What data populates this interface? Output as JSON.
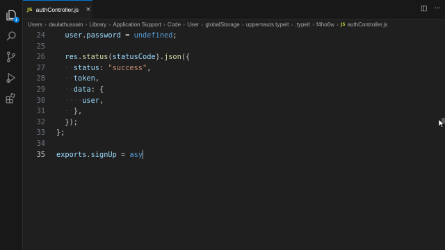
{
  "tab": {
    "label": "authController.js",
    "file_badge": "JS",
    "close": "×"
  },
  "tab_actions": {
    "split": "◫",
    "more": "···"
  },
  "breadcrumbs": [
    "Users",
    "daulathussain",
    "Library",
    "Application Support",
    "Code",
    "User",
    "globalStorage",
    "uppernauts.typeit",
    ".typeit",
    "f4ho6w",
    "authController.js"
  ],
  "breadcrumb_file_badge": "JS",
  "explorer_badge": "1",
  "lines": [
    {
      "n": "24",
      "indent": "",
      "code": [
        [
          "user",
          "#9cdcfe"
        ],
        [
          ".",
          "#cccccc"
        ],
        [
          "password",
          "#9cdcfe"
        ],
        [
          " = ",
          "#cccccc"
        ],
        [
          "undefined",
          "#569cd6"
        ],
        [
          ";",
          "#cccccc"
        ]
      ]
    },
    {
      "n": "25",
      "indent": "",
      "code": []
    },
    {
      "n": "26",
      "indent": "",
      "code": [
        [
          "res",
          "#9cdcfe"
        ],
        [
          ".",
          "#cccccc"
        ],
        [
          "status",
          "#dcdcaa"
        ],
        [
          "(",
          "#cccccc"
        ],
        [
          "statusCode",
          "#9cdcfe"
        ],
        [
          ").",
          "#cccccc"
        ],
        [
          "json",
          "#dcdcaa"
        ],
        [
          "({",
          "#cccccc"
        ]
      ]
    },
    {
      "n": "27",
      "indent": "··",
      "code": [
        [
          "status",
          "#9cdcfe"
        ],
        [
          ": ",
          "#cccccc"
        ],
        [
          "\"success\"",
          "#ce9178"
        ],
        [
          ",",
          "#cccccc"
        ]
      ]
    },
    {
      "n": "28",
      "indent": "··",
      "code": [
        [
          "token",
          "#9cdcfe"
        ],
        [
          ",",
          "#cccccc"
        ]
      ]
    },
    {
      "n": "29",
      "indent": "··",
      "code": [
        [
          "data",
          "#9cdcfe"
        ],
        [
          ": {",
          "#cccccc"
        ]
      ]
    },
    {
      "n": "30",
      "indent": "····",
      "code": [
        [
          "user",
          "#9cdcfe"
        ],
        [
          ",",
          "#cccccc"
        ]
      ]
    },
    {
      "n": "31",
      "indent": "··",
      "code": [
        [
          "},",
          "#cccccc"
        ]
      ]
    },
    {
      "n": "32",
      "indent": "",
      "code": [
        [
          "});",
          "#cccccc"
        ]
      ]
    },
    {
      "n": "33",
      "indent": "",
      "code": [
        [
          "};",
          "#cccccc"
        ]
      ]
    },
    {
      "n": "34",
      "indent": "",
      "code": []
    },
    {
      "n": "35",
      "indent": "",
      "code": [
        [
          "exports",
          "#9cdcfe"
        ],
        [
          ".",
          "#cccccc"
        ],
        [
          "signUp",
          "#9cdcfe"
        ],
        [
          " = ",
          "#cccccc"
        ],
        [
          "asy",
          "#569cd6"
        ]
      ],
      "active": true
    }
  ],
  "colors": {
    "accent": "#0078d4",
    "editor_bg": "#1f1f1f",
    "sidebar_bg": "#181818"
  }
}
